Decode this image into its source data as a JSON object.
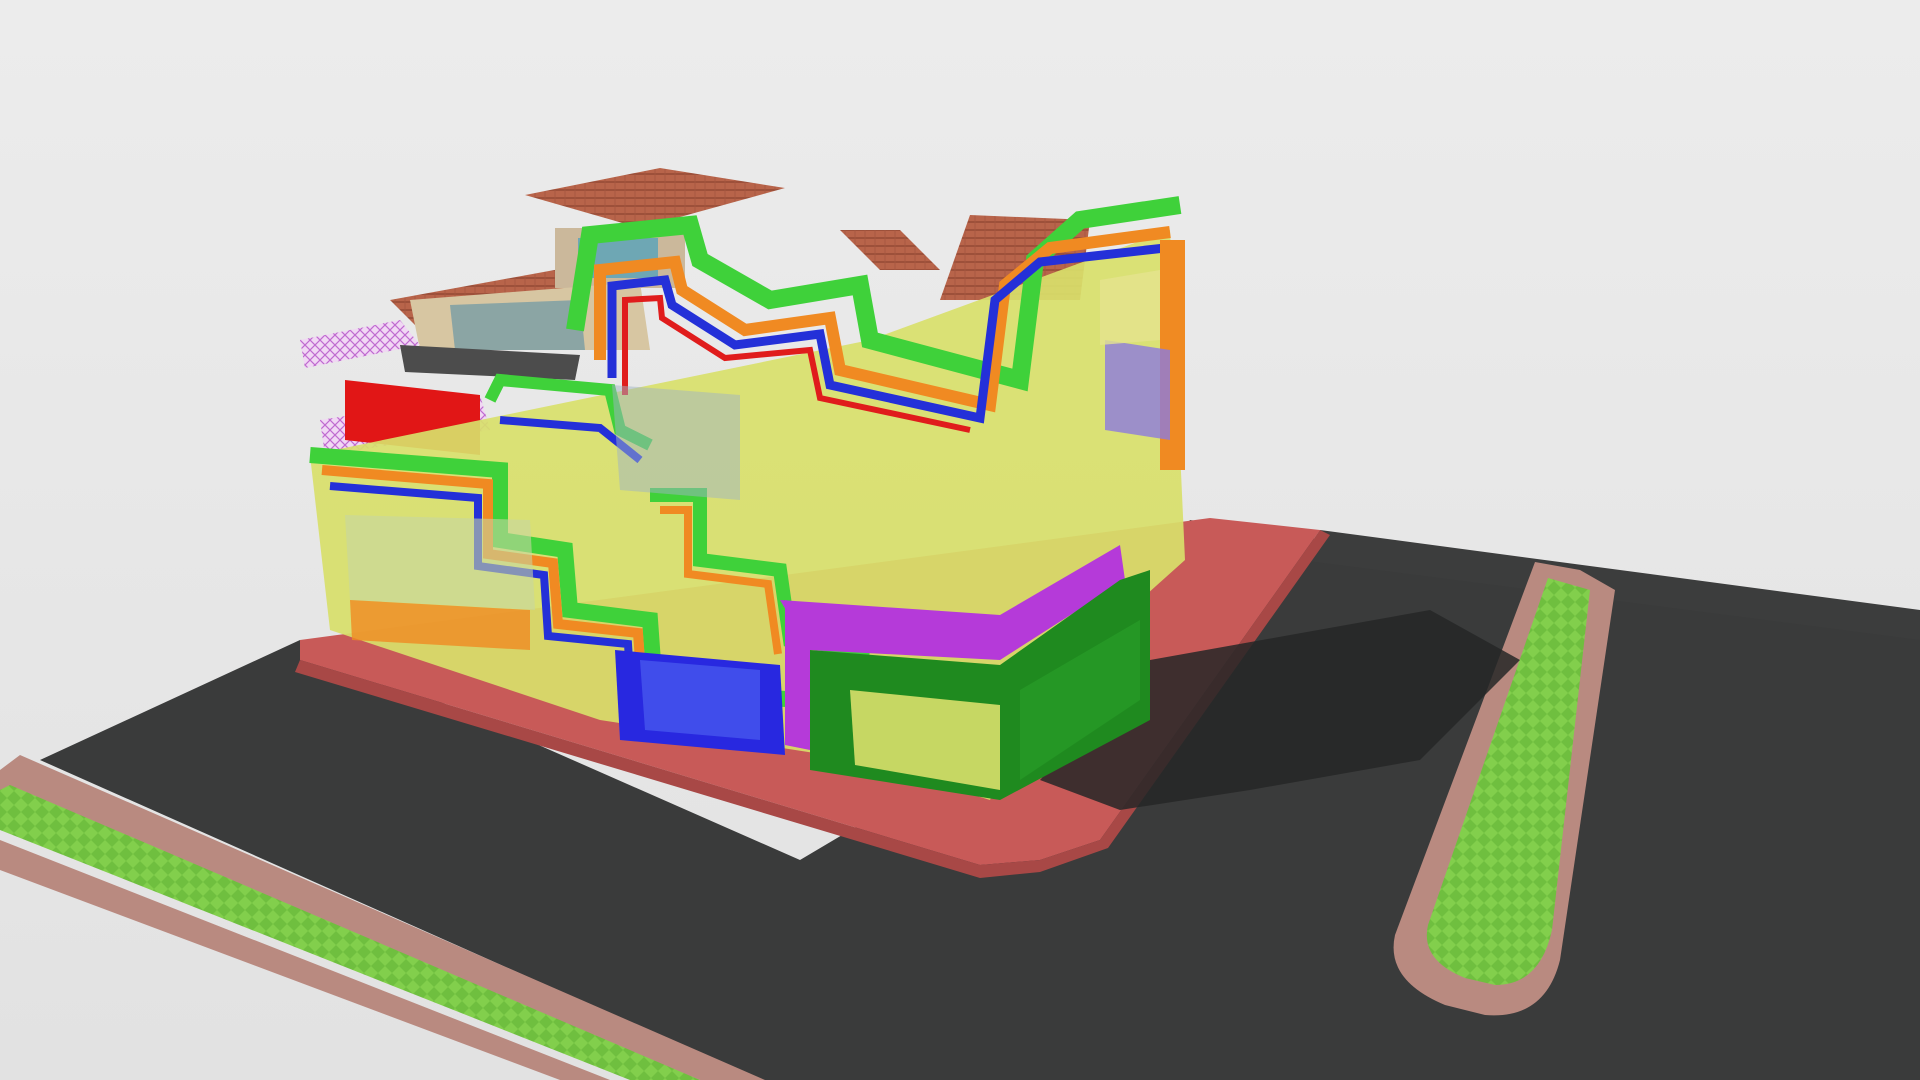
{
  "scene": {
    "type": "3d-model-viewport",
    "background_color": "#e6e6e6",
    "objects": [
      "road-asphalt",
      "sidewalk",
      "grass-median-left",
      "grass-median-right",
      "building-colorful-facade",
      "tiled-roofs",
      "balcony-railings"
    ],
    "colors": {
      "asphalt": "#3a3b3b",
      "sidewalk_red": "#c85a58",
      "curb_brick": "#b98a80",
      "grass": "#6fbf3f",
      "roof_tile": "#b9654a",
      "glass_yellow": "#d8df6a",
      "stripe_green": "#3fd13a",
      "stripe_orange": "#f08a22",
      "stripe_blue": "#2430d8",
      "stripe_red": "#e01c1c",
      "stripe_magenta": "#b53ad9",
      "dark_green": "#1f8a1f"
    }
  }
}
